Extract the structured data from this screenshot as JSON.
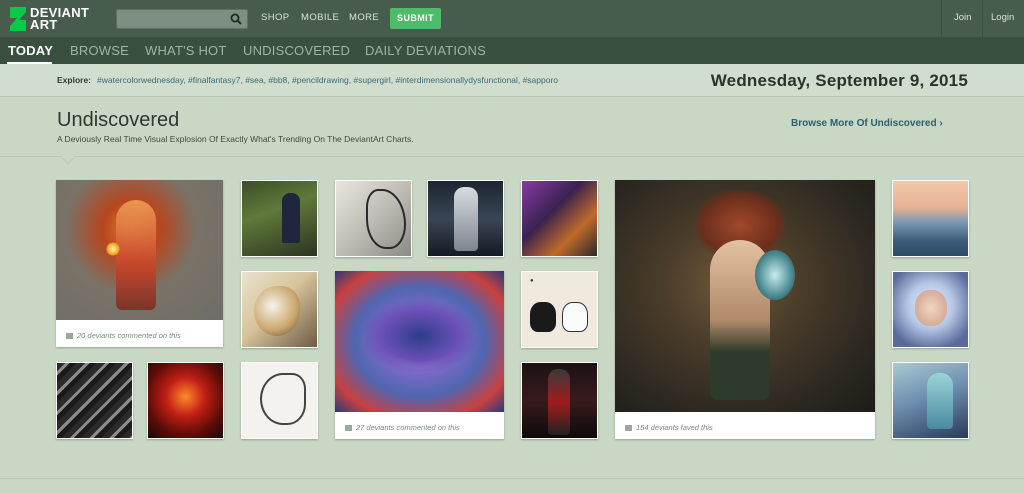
{
  "header": {
    "logo_line1": "DEVIANT",
    "logo_line2": "ART",
    "search_placeholder": "",
    "nav": [
      "SHOP",
      "MOBILE",
      "MORE"
    ],
    "submit_label": "SUBMIT",
    "join_label": "Join",
    "login_label": "Login"
  },
  "tabs": [
    "TODAY",
    "BROWSE",
    "WHAT'S HOT",
    "UNDISCOVERED",
    "DAILY DEVIATIONS"
  ],
  "explore": {
    "label": "Explore:",
    "tags": "#watercolorwednesday, #finalfantasy7, #sea, #bb8, #pencildrawing, #supergirl, #interdimensionallydysfunctional, #sapporo"
  },
  "date": "Wednesday, September 9, 2015",
  "section": {
    "title": "Undiscovered",
    "subtitle": "A Deviously Real Time Visual Explosion Of Exactly What's Trending On The DeviantArt Charts.",
    "browse_more": "Browse More Of Undiscovered ›"
  },
  "cards": [
    {
      "caption": "20 deviants commented on this"
    },
    {
      "caption": "27 deviants commented on this"
    },
    {
      "caption": "154 deviants faved this"
    }
  ],
  "colors": {
    "header": "#475c4d",
    "tabbar": "#3b4f40",
    "background": "#c9d8c5",
    "submit": "#4dbb6a",
    "accent_link": "#2c5e6b"
  }
}
